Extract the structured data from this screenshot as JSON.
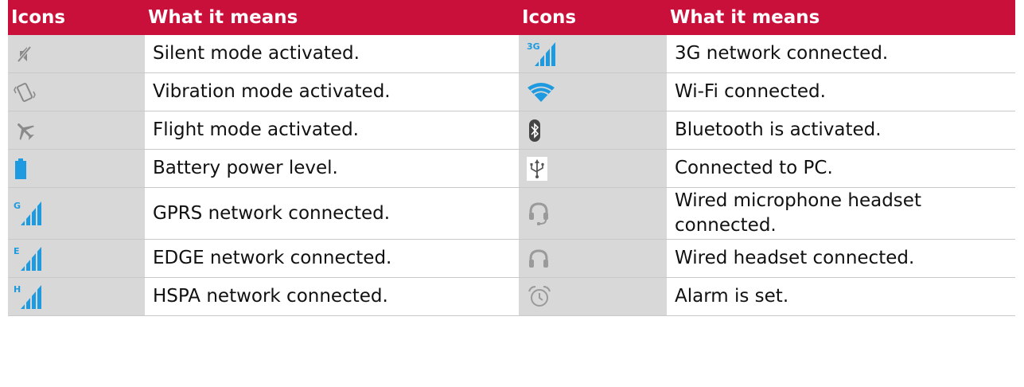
{
  "header": {
    "icons_label": "Icons",
    "meaning_label": "What it means"
  },
  "rows": [
    {
      "left": {
        "icon": "silent-mode-icon",
        "text": "Silent mode activated."
      },
      "right": {
        "icon": "network-3g-icon",
        "badge": "3G",
        "text": "3G network connected."
      }
    },
    {
      "left": {
        "icon": "vibration-mode-icon",
        "text": "Vibration mode activated."
      },
      "right": {
        "icon": "wifi-icon",
        "text": "Wi-Fi connected."
      }
    },
    {
      "left": {
        "icon": "airplane-icon",
        "text": "Flight mode activated."
      },
      "right": {
        "icon": "bluetooth-icon",
        "text": "Bluetooth is activated."
      }
    },
    {
      "left": {
        "icon": "battery-icon",
        "text": "Battery power level."
      },
      "right": {
        "icon": "usb-icon",
        "text": "Connected to PC."
      }
    },
    {
      "left": {
        "icon": "network-gprs-icon",
        "badge": "G",
        "text": "GPRS network connected."
      },
      "right": {
        "icon": "headset-mic-icon",
        "text": "Wired microphone headset connected."
      }
    },
    {
      "left": {
        "icon": "network-edge-icon",
        "badge": "E",
        "text": "EDGE network connected."
      },
      "right": {
        "icon": "headset-icon",
        "text": "Wired headset connected."
      }
    },
    {
      "left": {
        "icon": "network-hspa-icon",
        "badge": "H",
        "text": "HSPA network connected."
      },
      "right": {
        "icon": "alarm-icon",
        "text": "Alarm is set."
      }
    }
  ],
  "colors": {
    "header_bg": "#c8103a",
    "icon_cell_bg": "#d8d8d8",
    "signal_blue": "#1e9be0",
    "icon_gray": "#8a8a8a"
  }
}
